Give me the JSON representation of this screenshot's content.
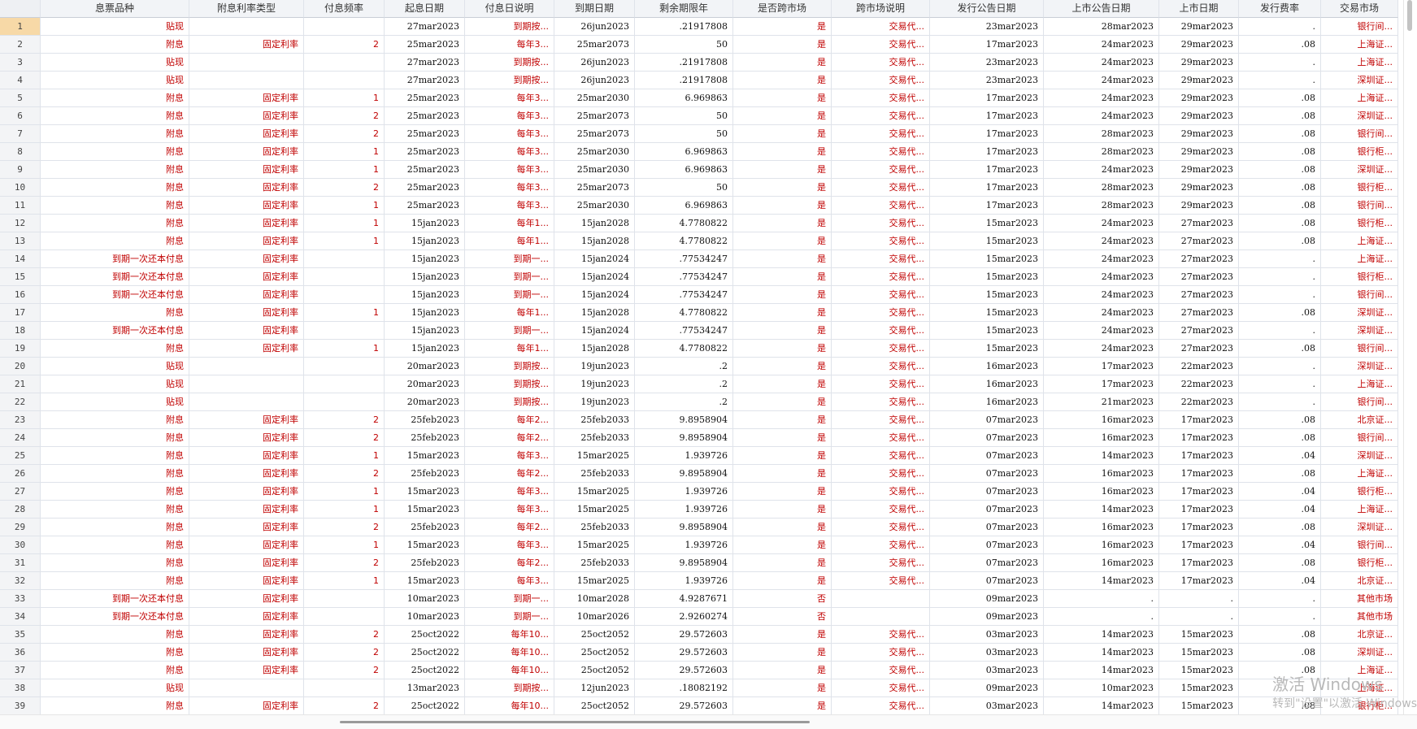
{
  "columns": [
    "息票品种",
    "附息利率类型",
    "付息频率",
    "起息日期",
    "付息日说明",
    "到期日期",
    "剩余期限年",
    "是否跨市场",
    "跨市场说明",
    "发行公告日期",
    "上市公告日期",
    "上市日期",
    "发行费率",
    "交易市场"
  ],
  "rows": [
    {
      "n": "1",
      "c": [
        "贴现",
        "",
        "",
        "27mar2023",
        "到期按...",
        "26jun2023",
        ".21917808",
        "是",
        "交易代...",
        "23mar2023",
        "28mar2023",
        "29mar2023",
        ".",
        "银行间..."
      ]
    },
    {
      "n": "2",
      "c": [
        "附息",
        "固定利率",
        "2",
        "25mar2023",
        "每年3...",
        "25mar2073",
        "50",
        "是",
        "交易代...",
        "17mar2023",
        "24mar2023",
        "29mar2023",
        ".08",
        "上海证..."
      ]
    },
    {
      "n": "3",
      "c": [
        "贴现",
        "",
        "",
        "27mar2023",
        "到期按...",
        "26jun2023",
        ".21917808",
        "是",
        "交易代...",
        "23mar2023",
        "24mar2023",
        "29mar2023",
        ".",
        "上海证..."
      ]
    },
    {
      "n": "4",
      "c": [
        "贴现",
        "",
        "",
        "27mar2023",
        "到期按...",
        "26jun2023",
        ".21917808",
        "是",
        "交易代...",
        "23mar2023",
        "24mar2023",
        "29mar2023",
        ".",
        "深圳证..."
      ]
    },
    {
      "n": "5",
      "c": [
        "附息",
        "固定利率",
        "1",
        "25mar2023",
        "每年3...",
        "25mar2030",
        "6.969863",
        "是",
        "交易代...",
        "17mar2023",
        "24mar2023",
        "29mar2023",
        ".08",
        "上海证..."
      ]
    },
    {
      "n": "6",
      "c": [
        "附息",
        "固定利率",
        "2",
        "25mar2023",
        "每年3...",
        "25mar2073",
        "50",
        "是",
        "交易代...",
        "17mar2023",
        "24mar2023",
        "29mar2023",
        ".08",
        "深圳证..."
      ]
    },
    {
      "n": "7",
      "c": [
        "附息",
        "固定利率",
        "2",
        "25mar2023",
        "每年3...",
        "25mar2073",
        "50",
        "是",
        "交易代...",
        "17mar2023",
        "28mar2023",
        "29mar2023",
        ".08",
        "银行间..."
      ]
    },
    {
      "n": "8",
      "c": [
        "附息",
        "固定利率",
        "1",
        "25mar2023",
        "每年3...",
        "25mar2030",
        "6.969863",
        "是",
        "交易代...",
        "17mar2023",
        "28mar2023",
        "29mar2023",
        ".08",
        "银行柜..."
      ]
    },
    {
      "n": "9",
      "c": [
        "附息",
        "固定利率",
        "1",
        "25mar2023",
        "每年3...",
        "25mar2030",
        "6.969863",
        "是",
        "交易代...",
        "17mar2023",
        "24mar2023",
        "29mar2023",
        ".08",
        "深圳证..."
      ]
    },
    {
      "n": "10",
      "c": [
        "附息",
        "固定利率",
        "2",
        "25mar2023",
        "每年3...",
        "25mar2073",
        "50",
        "是",
        "交易代...",
        "17mar2023",
        "28mar2023",
        "29mar2023",
        ".08",
        "银行柜..."
      ]
    },
    {
      "n": "11",
      "c": [
        "附息",
        "固定利率",
        "1",
        "25mar2023",
        "每年3...",
        "25mar2030",
        "6.969863",
        "是",
        "交易代...",
        "17mar2023",
        "28mar2023",
        "29mar2023",
        ".08",
        "银行间..."
      ]
    },
    {
      "n": "12",
      "c": [
        "附息",
        "固定利率",
        "1",
        "15jan2023",
        "每年1...",
        "15jan2028",
        "4.7780822",
        "是",
        "交易代...",
        "15mar2023",
        "24mar2023",
        "27mar2023",
        ".08",
        "银行柜..."
      ]
    },
    {
      "n": "13",
      "c": [
        "附息",
        "固定利率",
        "1",
        "15jan2023",
        "每年1...",
        "15jan2028",
        "4.7780822",
        "是",
        "交易代...",
        "15mar2023",
        "24mar2023",
        "27mar2023",
        ".08",
        "上海证..."
      ]
    },
    {
      "n": "14",
      "c": [
        "到期一次还本付息",
        "固定利率",
        "",
        "15jan2023",
        "到期一...",
        "15jan2024",
        ".77534247",
        "是",
        "交易代...",
        "15mar2023",
        "24mar2023",
        "27mar2023",
        ".",
        "上海证..."
      ]
    },
    {
      "n": "15",
      "c": [
        "到期一次还本付息",
        "固定利率",
        "",
        "15jan2023",
        "到期一...",
        "15jan2024",
        ".77534247",
        "是",
        "交易代...",
        "15mar2023",
        "24mar2023",
        "27mar2023",
        ".",
        "银行柜..."
      ]
    },
    {
      "n": "16",
      "c": [
        "到期一次还本付息",
        "固定利率",
        "",
        "15jan2023",
        "到期一...",
        "15jan2024",
        ".77534247",
        "是",
        "交易代...",
        "15mar2023",
        "24mar2023",
        "27mar2023",
        ".",
        "银行间..."
      ]
    },
    {
      "n": "17",
      "c": [
        "附息",
        "固定利率",
        "1",
        "15jan2023",
        "每年1...",
        "15jan2028",
        "4.7780822",
        "是",
        "交易代...",
        "15mar2023",
        "24mar2023",
        "27mar2023",
        ".08",
        "深圳证..."
      ]
    },
    {
      "n": "18",
      "c": [
        "到期一次还本付息",
        "固定利率",
        "",
        "15jan2023",
        "到期一...",
        "15jan2024",
        ".77534247",
        "是",
        "交易代...",
        "15mar2023",
        "24mar2023",
        "27mar2023",
        ".",
        "深圳证..."
      ]
    },
    {
      "n": "19",
      "c": [
        "附息",
        "固定利率",
        "1",
        "15jan2023",
        "每年1...",
        "15jan2028",
        "4.7780822",
        "是",
        "交易代...",
        "15mar2023",
        "24mar2023",
        "27mar2023",
        ".08",
        "银行间..."
      ]
    },
    {
      "n": "20",
      "c": [
        "贴现",
        "",
        "",
        "20mar2023",
        "到期按...",
        "19jun2023",
        ".2",
        "是",
        "交易代...",
        "16mar2023",
        "17mar2023",
        "22mar2023",
        ".",
        "深圳证..."
      ]
    },
    {
      "n": "21",
      "c": [
        "贴现",
        "",
        "",
        "20mar2023",
        "到期按...",
        "19jun2023",
        ".2",
        "是",
        "交易代...",
        "16mar2023",
        "17mar2023",
        "22mar2023",
        ".",
        "上海证..."
      ]
    },
    {
      "n": "22",
      "c": [
        "贴现",
        "",
        "",
        "20mar2023",
        "到期按...",
        "19jun2023",
        ".2",
        "是",
        "交易代...",
        "16mar2023",
        "21mar2023",
        "22mar2023",
        ".",
        "银行间..."
      ]
    },
    {
      "n": "23",
      "c": [
        "附息",
        "固定利率",
        "2",
        "25feb2023",
        "每年2...",
        "25feb2033",
        "9.8958904",
        "是",
        "交易代...",
        "07mar2023",
        "16mar2023",
        "17mar2023",
        ".08",
        "北京证..."
      ]
    },
    {
      "n": "24",
      "c": [
        "附息",
        "固定利率",
        "2",
        "25feb2023",
        "每年2...",
        "25feb2033",
        "9.8958904",
        "是",
        "交易代...",
        "07mar2023",
        "16mar2023",
        "17mar2023",
        ".08",
        "银行间..."
      ]
    },
    {
      "n": "25",
      "c": [
        "附息",
        "固定利率",
        "1",
        "15mar2023",
        "每年3...",
        "15mar2025",
        "1.939726",
        "是",
        "交易代...",
        "07mar2023",
        "14mar2023",
        "17mar2023",
        ".04",
        "深圳证..."
      ]
    },
    {
      "n": "26",
      "c": [
        "附息",
        "固定利率",
        "2",
        "25feb2023",
        "每年2...",
        "25feb2033",
        "9.8958904",
        "是",
        "交易代...",
        "07mar2023",
        "16mar2023",
        "17mar2023",
        ".08",
        "上海证..."
      ]
    },
    {
      "n": "27",
      "c": [
        "附息",
        "固定利率",
        "1",
        "15mar2023",
        "每年3...",
        "15mar2025",
        "1.939726",
        "是",
        "交易代...",
        "07mar2023",
        "16mar2023",
        "17mar2023",
        ".04",
        "银行柜..."
      ]
    },
    {
      "n": "28",
      "c": [
        "附息",
        "固定利率",
        "1",
        "15mar2023",
        "每年3...",
        "15mar2025",
        "1.939726",
        "是",
        "交易代...",
        "07mar2023",
        "14mar2023",
        "17mar2023",
        ".04",
        "上海证..."
      ]
    },
    {
      "n": "29",
      "c": [
        "附息",
        "固定利率",
        "2",
        "25feb2023",
        "每年2...",
        "25feb2033",
        "9.8958904",
        "是",
        "交易代...",
        "07mar2023",
        "16mar2023",
        "17mar2023",
        ".08",
        "深圳证..."
      ]
    },
    {
      "n": "30",
      "c": [
        "附息",
        "固定利率",
        "1",
        "15mar2023",
        "每年3...",
        "15mar2025",
        "1.939726",
        "是",
        "交易代...",
        "07mar2023",
        "16mar2023",
        "17mar2023",
        ".04",
        "银行间..."
      ]
    },
    {
      "n": "31",
      "c": [
        "附息",
        "固定利率",
        "2",
        "25feb2023",
        "每年2...",
        "25feb2033",
        "9.8958904",
        "是",
        "交易代...",
        "07mar2023",
        "16mar2023",
        "17mar2023",
        ".08",
        "银行柜..."
      ]
    },
    {
      "n": "32",
      "c": [
        "附息",
        "固定利率",
        "1",
        "15mar2023",
        "每年3...",
        "15mar2025",
        "1.939726",
        "是",
        "交易代...",
        "07mar2023",
        "14mar2023",
        "17mar2023",
        ".04",
        "北京证..."
      ]
    },
    {
      "n": "33",
      "c": [
        "到期一次还本付息",
        "固定利率",
        "",
        "10mar2023",
        "到期一...",
        "10mar2028",
        "4.9287671",
        "否",
        "",
        "09mar2023",
        ".",
        ".",
        ".",
        "其他市场"
      ]
    },
    {
      "n": "34",
      "c": [
        "到期一次还本付息",
        "固定利率",
        "",
        "10mar2023",
        "到期一...",
        "10mar2026",
        "2.9260274",
        "否",
        "",
        "09mar2023",
        ".",
        ".",
        ".",
        "其他市场"
      ]
    },
    {
      "n": "35",
      "c": [
        "附息",
        "固定利率",
        "2",
        "25oct2022",
        "每年10...",
        "25oct2052",
        "29.572603",
        "是",
        "交易代...",
        "03mar2023",
        "14mar2023",
        "15mar2023",
        ".08",
        "北京证..."
      ]
    },
    {
      "n": "36",
      "c": [
        "附息",
        "固定利率",
        "2",
        "25oct2022",
        "每年10...",
        "25oct2052",
        "29.572603",
        "是",
        "交易代...",
        "03mar2023",
        "14mar2023",
        "15mar2023",
        ".08",
        "深圳证..."
      ]
    },
    {
      "n": "37",
      "c": [
        "附息",
        "固定利率",
        "2",
        "25oct2022",
        "每年10...",
        "25oct2052",
        "29.572603",
        "是",
        "交易代...",
        "03mar2023",
        "14mar2023",
        "15mar2023",
        ".08",
        "上海证..."
      ]
    },
    {
      "n": "38",
      "c": [
        "贴现",
        "",
        "",
        "13mar2023",
        "到期按...",
        "12jun2023",
        ".18082192",
        "是",
        "交易代...",
        "09mar2023",
        "10mar2023",
        "15mar2023",
        ".",
        "上海证..."
      ]
    },
    {
      "n": "39",
      "c": [
        "附息",
        "固定利率",
        "2",
        "25oct2022",
        "每年10...",
        "25oct2052",
        "29.572603",
        "是",
        "交易代...",
        "03mar2023",
        "14mar2023",
        "15mar2023",
        ".08",
        "银行柜..."
      ]
    }
  ],
  "watermark": {
    "line1": "激活 Windows",
    "line2": "转到\"设置\"以激活 Windows"
  }
}
